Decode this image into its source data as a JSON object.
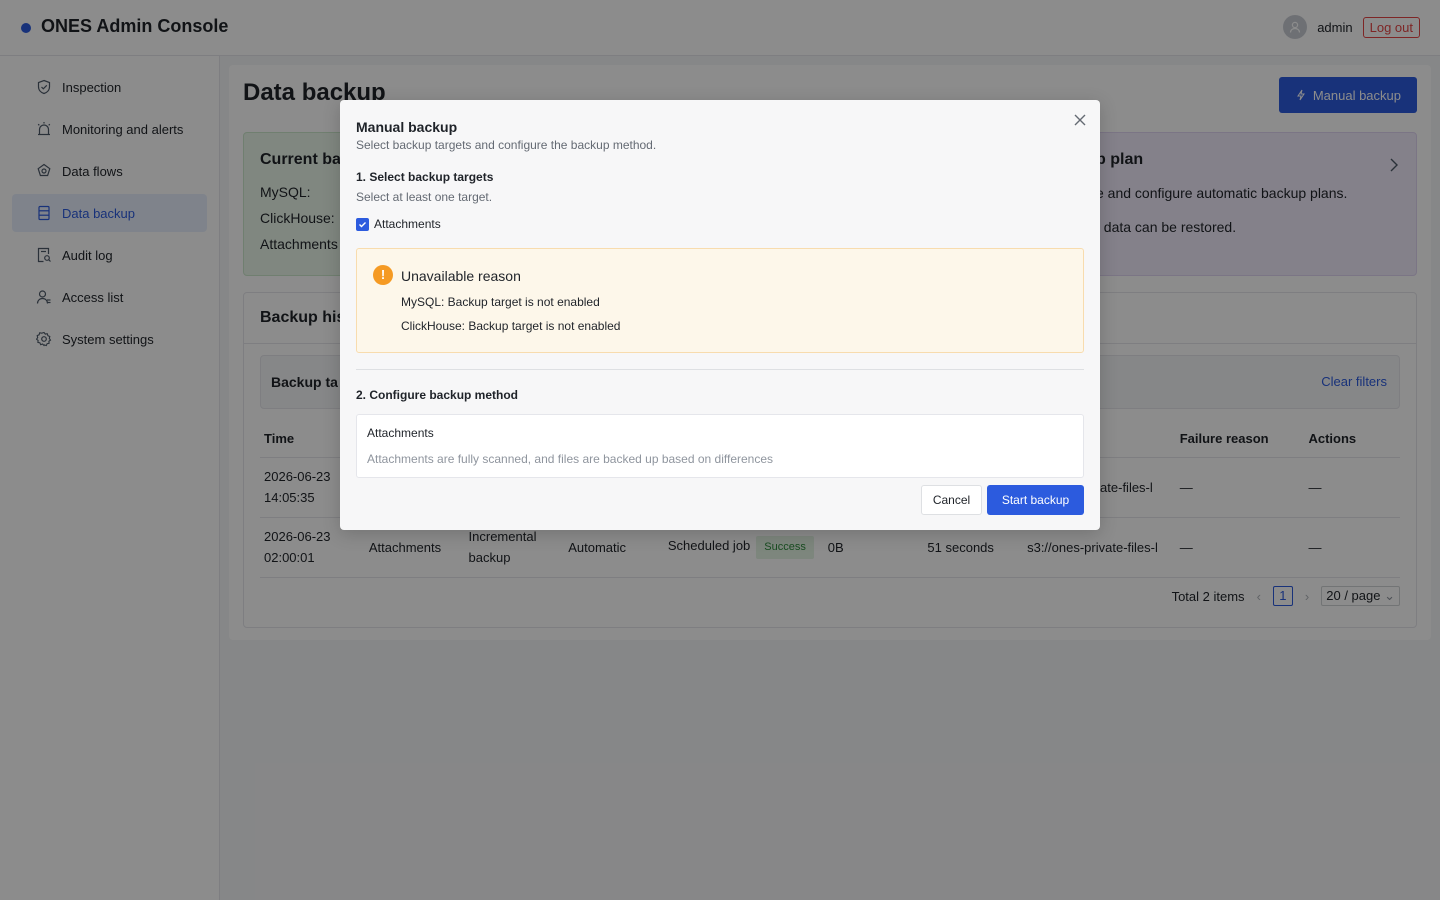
{
  "header": {
    "app_title": "ONES Admin Console",
    "user_name": "admin",
    "logout_label": "Log out"
  },
  "sidebar": {
    "items": [
      {
        "label": "Inspection",
        "icon": "shield-check-icon",
        "active": false
      },
      {
        "label": "Monitoring and alerts",
        "icon": "alarm-icon",
        "active": false
      },
      {
        "label": "Data flows",
        "icon": "flow-icon",
        "active": false
      },
      {
        "label": "Data backup",
        "icon": "database-icon",
        "active": true
      },
      {
        "label": "Audit log",
        "icon": "audit-icon",
        "active": false
      },
      {
        "label": "Access list",
        "icon": "user-list-icon",
        "active": false
      },
      {
        "label": "System settings",
        "icon": "gear-icon",
        "active": false
      }
    ]
  },
  "main": {
    "page_title": "Data backup",
    "manual_backup_label": "Manual backup",
    "current_card": {
      "title": "Current bac",
      "rows": [
        "MySQL:",
        "ClickHouse:",
        "Attachments"
      ]
    },
    "plan_card": {
      "title": "p plan",
      "line1": "e and configure automatic backup plans.",
      "line2": "; data can be restored."
    },
    "history": {
      "title": "Backup his",
      "filter_label": "Backup ta",
      "clear_filters": "Clear filters",
      "columns": [
        "Time",
        "",
        "",
        "",
        "",
        "",
        "",
        "ath",
        "Failure reason",
        "Actions"
      ],
      "rows": [
        {
          "time_date": "2026-06-23",
          "time_clock": "14:05:35",
          "target": "",
          "type_1": "",
          "type_2": "",
          "trigger": "",
          "source": "",
          "status": "",
          "size": "",
          "duration": "",
          "path": "private-files-l",
          "failure": "—",
          "actions": "—"
        },
        {
          "time_date": "2026-06-23",
          "time_clock": "02:00:01",
          "target": "Attachments",
          "type_1": "Incremental",
          "type_2": "backup",
          "trigger": "Automatic",
          "source": "Scheduled job",
          "status": "Success",
          "size": "0B",
          "duration": "51 seconds",
          "path": "s3://ones-private-files-l",
          "failure": "—",
          "actions": "—"
        }
      ],
      "pagination": {
        "total": "Total 2 items",
        "current_page": "1",
        "page_size": "20 / page"
      }
    }
  },
  "modal": {
    "title": "Manual backup",
    "subtitle": "Select backup targets and configure the backup method.",
    "step1_title": "1. Select backup targets",
    "step1_hint": "Select at least one target.",
    "checkbox_label": "Attachments",
    "checkbox_checked": true,
    "alert": {
      "title": "Unavailable reason",
      "icon_glyph": "!",
      "lines": [
        "MySQL: Backup target is not enabled",
        "ClickHouse: Backup target is not enabled"
      ]
    },
    "step2_title": "2. Configure backup method",
    "method": {
      "name": "Attachments",
      "description": "Attachments are fully scanned, and files are backed up based on differences"
    },
    "cancel_label": "Cancel",
    "start_label": "Start backup"
  },
  "colors": {
    "primary": "#2c5bde",
    "danger": "#e54545",
    "warning": "#f59a23",
    "success": "#2e8b3d"
  }
}
